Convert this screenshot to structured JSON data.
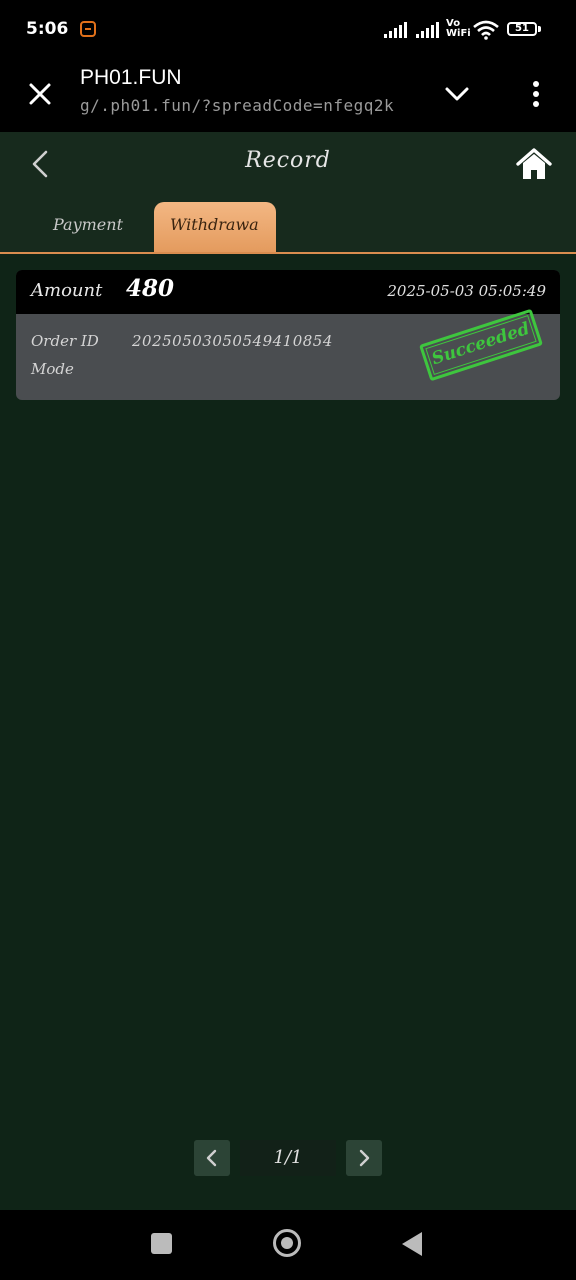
{
  "status_bar": {
    "time": "5:06",
    "network_label_top": "Vo",
    "network_label_bottom": "WiFi",
    "battery": "51"
  },
  "browser": {
    "title": "PH01.FUN",
    "url": "g/.ph01.fun/?spreadCode=nfegq2k",
    "close_icon": "close-icon",
    "expand_icon": "chevron-down-icon",
    "menu_icon": "more-vertical-icon"
  },
  "header": {
    "title": "Record",
    "back_icon": "chevron-left-icon",
    "home_icon": "home-icon"
  },
  "tabs": [
    {
      "label": "Payment",
      "active": false
    },
    {
      "label": "Withdrawa",
      "active": true
    }
  ],
  "records": [
    {
      "amount_label": "Amount",
      "amount": "480",
      "time": "2025-05-03 05:05:49",
      "order_id_label": "Order ID",
      "order_id": "20250503050549410854",
      "mode_label": "Mode",
      "mode": "",
      "status": "Succeeded"
    }
  ],
  "pagination": {
    "label": "1/1"
  },
  "colors": {
    "accent": "#e49b5e",
    "background": "#0f2417",
    "stamp": "#3ec63e"
  }
}
